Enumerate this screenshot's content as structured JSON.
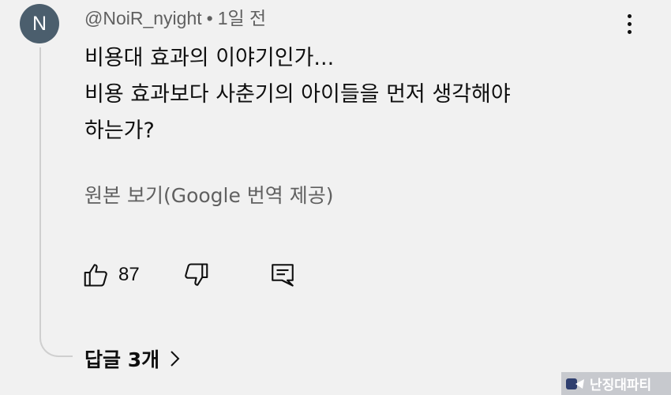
{
  "comment": {
    "avatar_letter": "N",
    "author": "@NoiR_nyight",
    "separator": "•",
    "time": "1일 전",
    "lines": [
      "비용대 효과의 이야기인가...",
      "비용 효과보다 사춘기의 아이들을 먼저 생각해야",
      "하는가?"
    ],
    "translate_label": "원본 보기(Google 번역 제공)",
    "like_count": "87",
    "replies_label": "답글 3개",
    "icons": {
      "more": "vertical-dots-icon",
      "like": "thumbs-up-icon",
      "dislike": "thumbs-down-icon",
      "reply": "comment-icon",
      "replies_chevron": "chevron-right-icon"
    }
  },
  "watermark": {
    "text": "난징대파티"
  },
  "colors": {
    "background": "#f1f1f1",
    "avatar": "#4b5e6d",
    "primary_text": "#0f0f0f",
    "secondary_text": "#606060",
    "thread_line": "#cfcfcf"
  }
}
